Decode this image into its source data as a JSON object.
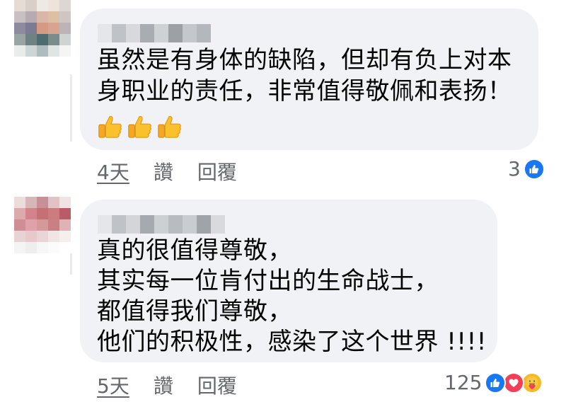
{
  "comments": [
    {
      "text_lines": [
        "虽然是有身体的缺陷，但却有负上对本",
        "身职业的责任，非常值得敬佩和表扬！"
      ],
      "emojis": [
        "thumbs-up",
        "thumbs-up",
        "thumbs-up"
      ],
      "time": "4天",
      "like_label": "讚",
      "reply_label": "回覆",
      "reaction_count": "3",
      "reactions": [
        "like"
      ]
    },
    {
      "text_lines": [
        "真的很值得尊敬，",
        "其实每一位肯付出的生命战士，",
        "都值得我们尊敬，",
        "他们的积极性，感染了这个世界 !!!!"
      ],
      "time": "5天",
      "like_label": "讚",
      "reply_label": "回覆",
      "reaction_count": "125",
      "reactions": [
        "like",
        "love",
        "care"
      ]
    }
  ],
  "colors": {
    "bubble": "#f0f2f5",
    "meta_text": "#65676b",
    "like_blue": "#1877f2",
    "love_red": "#f33e58",
    "care_yellow": "#f7b928"
  }
}
